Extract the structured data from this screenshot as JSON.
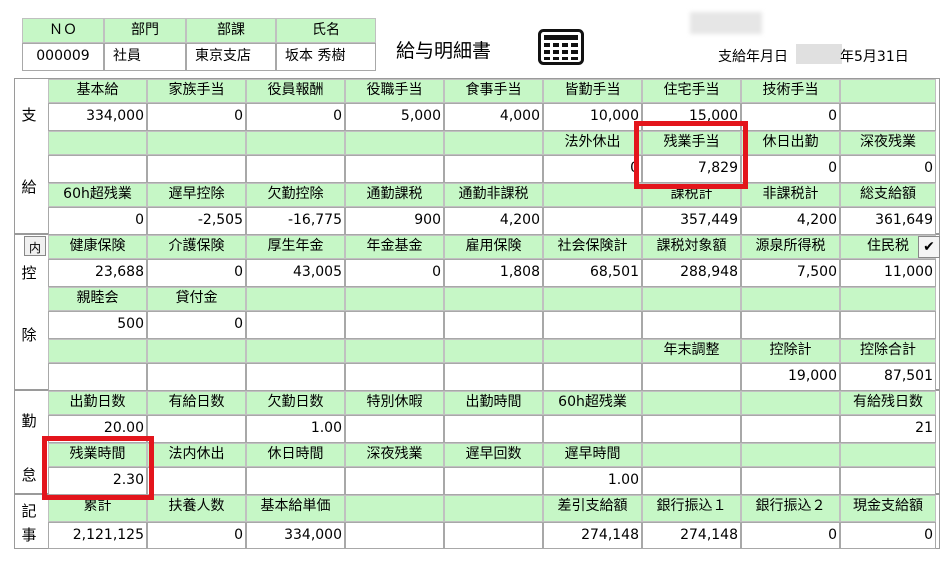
{
  "header": {
    "col_labels": [
      "ＮＯ",
      "部門",
      "部課",
      "氏名"
    ],
    "col_values": [
      "000009",
      "社員",
      "東京支店",
      "坂本 秀樹"
    ],
    "title": "給与明細書",
    "pay_date_label": "支給年月日",
    "pay_date_suffix": "年5月31日"
  },
  "sections": {
    "pay": [
      "支",
      "給"
    ],
    "deduct": [
      "控",
      "除"
    ],
    "attendance": [
      "勤",
      "怠"
    ],
    "notes": [
      "記",
      "事"
    ],
    "inner_tab": "内",
    "check": "✔"
  },
  "pay": {
    "r1_labels": [
      "基本給",
      "家族手当",
      "役員報酬",
      "役職手当",
      "食事手当",
      "皆勤手当",
      "住宅手当",
      "技術手当",
      ""
    ],
    "r1_values": [
      "334,000",
      "0",
      "0",
      "5,000",
      "4,000",
      "10,000",
      "15,000",
      "0",
      ""
    ],
    "r2_labels": [
      "",
      "",
      "",
      "",
      "",
      "法外休出",
      "残業手当",
      "休日出勤",
      "深夜残業"
    ],
    "r2_values": [
      "",
      "",
      "",
      "",
      "",
      "0",
      "7,829",
      "0",
      "0"
    ],
    "r3_labels": [
      "60h超残業",
      "遅早控除",
      "欠勤控除",
      "通勤課税",
      "通勤非課税",
      "",
      "課税計",
      "非課税計",
      "総支給額"
    ],
    "r3_values": [
      "0",
      "-2,505",
      "-16,775",
      "900",
      "4,200",
      "",
      "357,449",
      "4,200",
      "361,649"
    ]
  },
  "deduct": {
    "r1_labels": [
      "健康保険",
      "介護保険",
      "厚生年金",
      "年金基金",
      "雇用保険",
      "社会保険計",
      "課税対象額",
      "源泉所得税",
      "住民税"
    ],
    "r1_values": [
      "23,688",
      "0",
      "43,005",
      "0",
      "1,808",
      "68,501",
      "288,948",
      "7,500",
      "11,000"
    ],
    "r2_labels": [
      "親睦会",
      "貸付金",
      "",
      "",
      "",
      "",
      "",
      "",
      ""
    ],
    "r2_values": [
      "500",
      "0",
      "",
      "",
      "",
      "",
      "",
      "",
      ""
    ],
    "r3_labels": [
      "",
      "",
      "",
      "",
      "",
      "",
      "年末調整",
      "控除計",
      "控除合計"
    ],
    "r3_values": [
      "",
      "",
      "",
      "",
      "",
      "",
      "",
      "19,000",
      "87,501"
    ]
  },
  "attendance": {
    "r1_labels": [
      "出勤日数",
      "有給日数",
      "欠勤日数",
      "特別休暇",
      "出勤時間",
      "60h超残業",
      "",
      "",
      "有給残日数"
    ],
    "r1_values": [
      "20.00",
      "",
      "1.00",
      "",
      "",
      "",
      "",
      "",
      "21"
    ],
    "r2_labels": [
      "残業時間",
      "法内休出",
      "休日時間",
      "深夜残業",
      "遅早回数",
      "遅早時間",
      "",
      "",
      ""
    ],
    "r2_values": [
      "2.30",
      "",
      "",
      "",
      "",
      "1.00",
      "",
      "",
      ""
    ]
  },
  "notes": {
    "labels": [
      "累計",
      "扶養人数",
      "基本給単価",
      "",
      "",
      "差引支給額",
      "銀行振込１",
      "銀行振込２",
      "現金支給額"
    ],
    "values": [
      "2,121,125",
      "0",
      "334,000",
      "",
      "",
      "274,148",
      "274,148",
      "0",
      "0"
    ]
  }
}
